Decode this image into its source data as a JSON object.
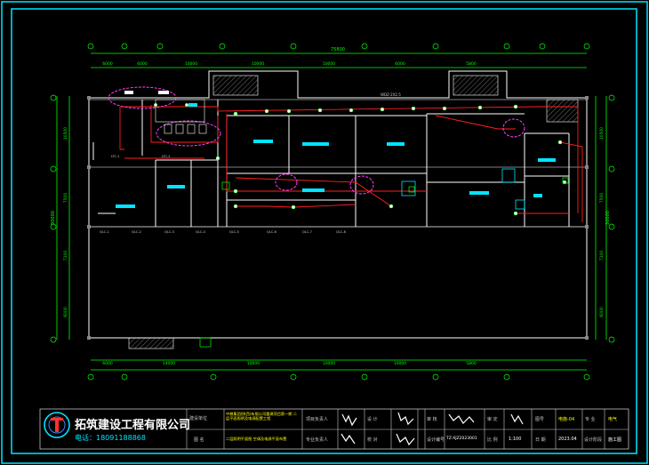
{
  "drawing": {
    "colors": {
      "frame": "#00e5ff",
      "dimension": "#00ff00",
      "wall": "#ffffff",
      "circuit": "#ff2020",
      "cloud": "#ff40ff",
      "room_tag": "#00e5ff",
      "label": "#c8c8c8",
      "title_yellow": "#ffff00",
      "company": "#ffffff"
    },
    "dims_top_segments": [
      "6000",
      "6000",
      "10000",
      "10000",
      "10000",
      "6000",
      "5800"
    ],
    "dim_top_total": "75800",
    "dims_bottom_segments": [
      "6000",
      "14000",
      "10000",
      "10000",
      "10000",
      "5800"
    ],
    "dims_left_segments": [
      "10500",
      "7500",
      "7100",
      "6000"
    ],
    "dim_left_total": "30000",
    "dims_right_segments": [
      "10500",
      "7500",
      "7100",
      "6000"
    ],
    "dim_right_total": "30000",
    "wiring_label": "WDZ-2X2.5",
    "door_labels": [
      "QLC-1",
      "QLC-2",
      "QLC-3",
      "QLC-4",
      "QLC-5",
      "QLC-6",
      "QLC-7",
      "QLC-8"
    ],
    "panel_labels": [
      "LTC-1",
      "LTC-2"
    ]
  },
  "title_block": {
    "company": "拓筑建设工程有限公司",
    "phone": "电话：18091188868",
    "project_label": "建设单位",
    "project_name": "中粮集团(陕西)有限公司重建项目第一期 二层平面照明及电源配置工程",
    "drawing_label": "图 名",
    "drawing_name": "二层照明平面图 空调及电源平面布置",
    "role_project_lead": "项目负责人",
    "role_design": "设 计",
    "role_review": "审 核",
    "role_discipline_lead": "专业负责人",
    "role_check": "校 对",
    "role_approve": "审 定",
    "design_no_label": "设计编号",
    "design_no": "TZ-XJZ2023001",
    "scale_label": "比 例",
    "scale": "1:100",
    "date_label": "日 期",
    "date": "2023.04",
    "sheet_label": "图号",
    "sheet_no": "电施-04",
    "discipline_label": "专 业",
    "discipline": "电气",
    "stage_label": "设计阶段",
    "stage": "施工图"
  }
}
